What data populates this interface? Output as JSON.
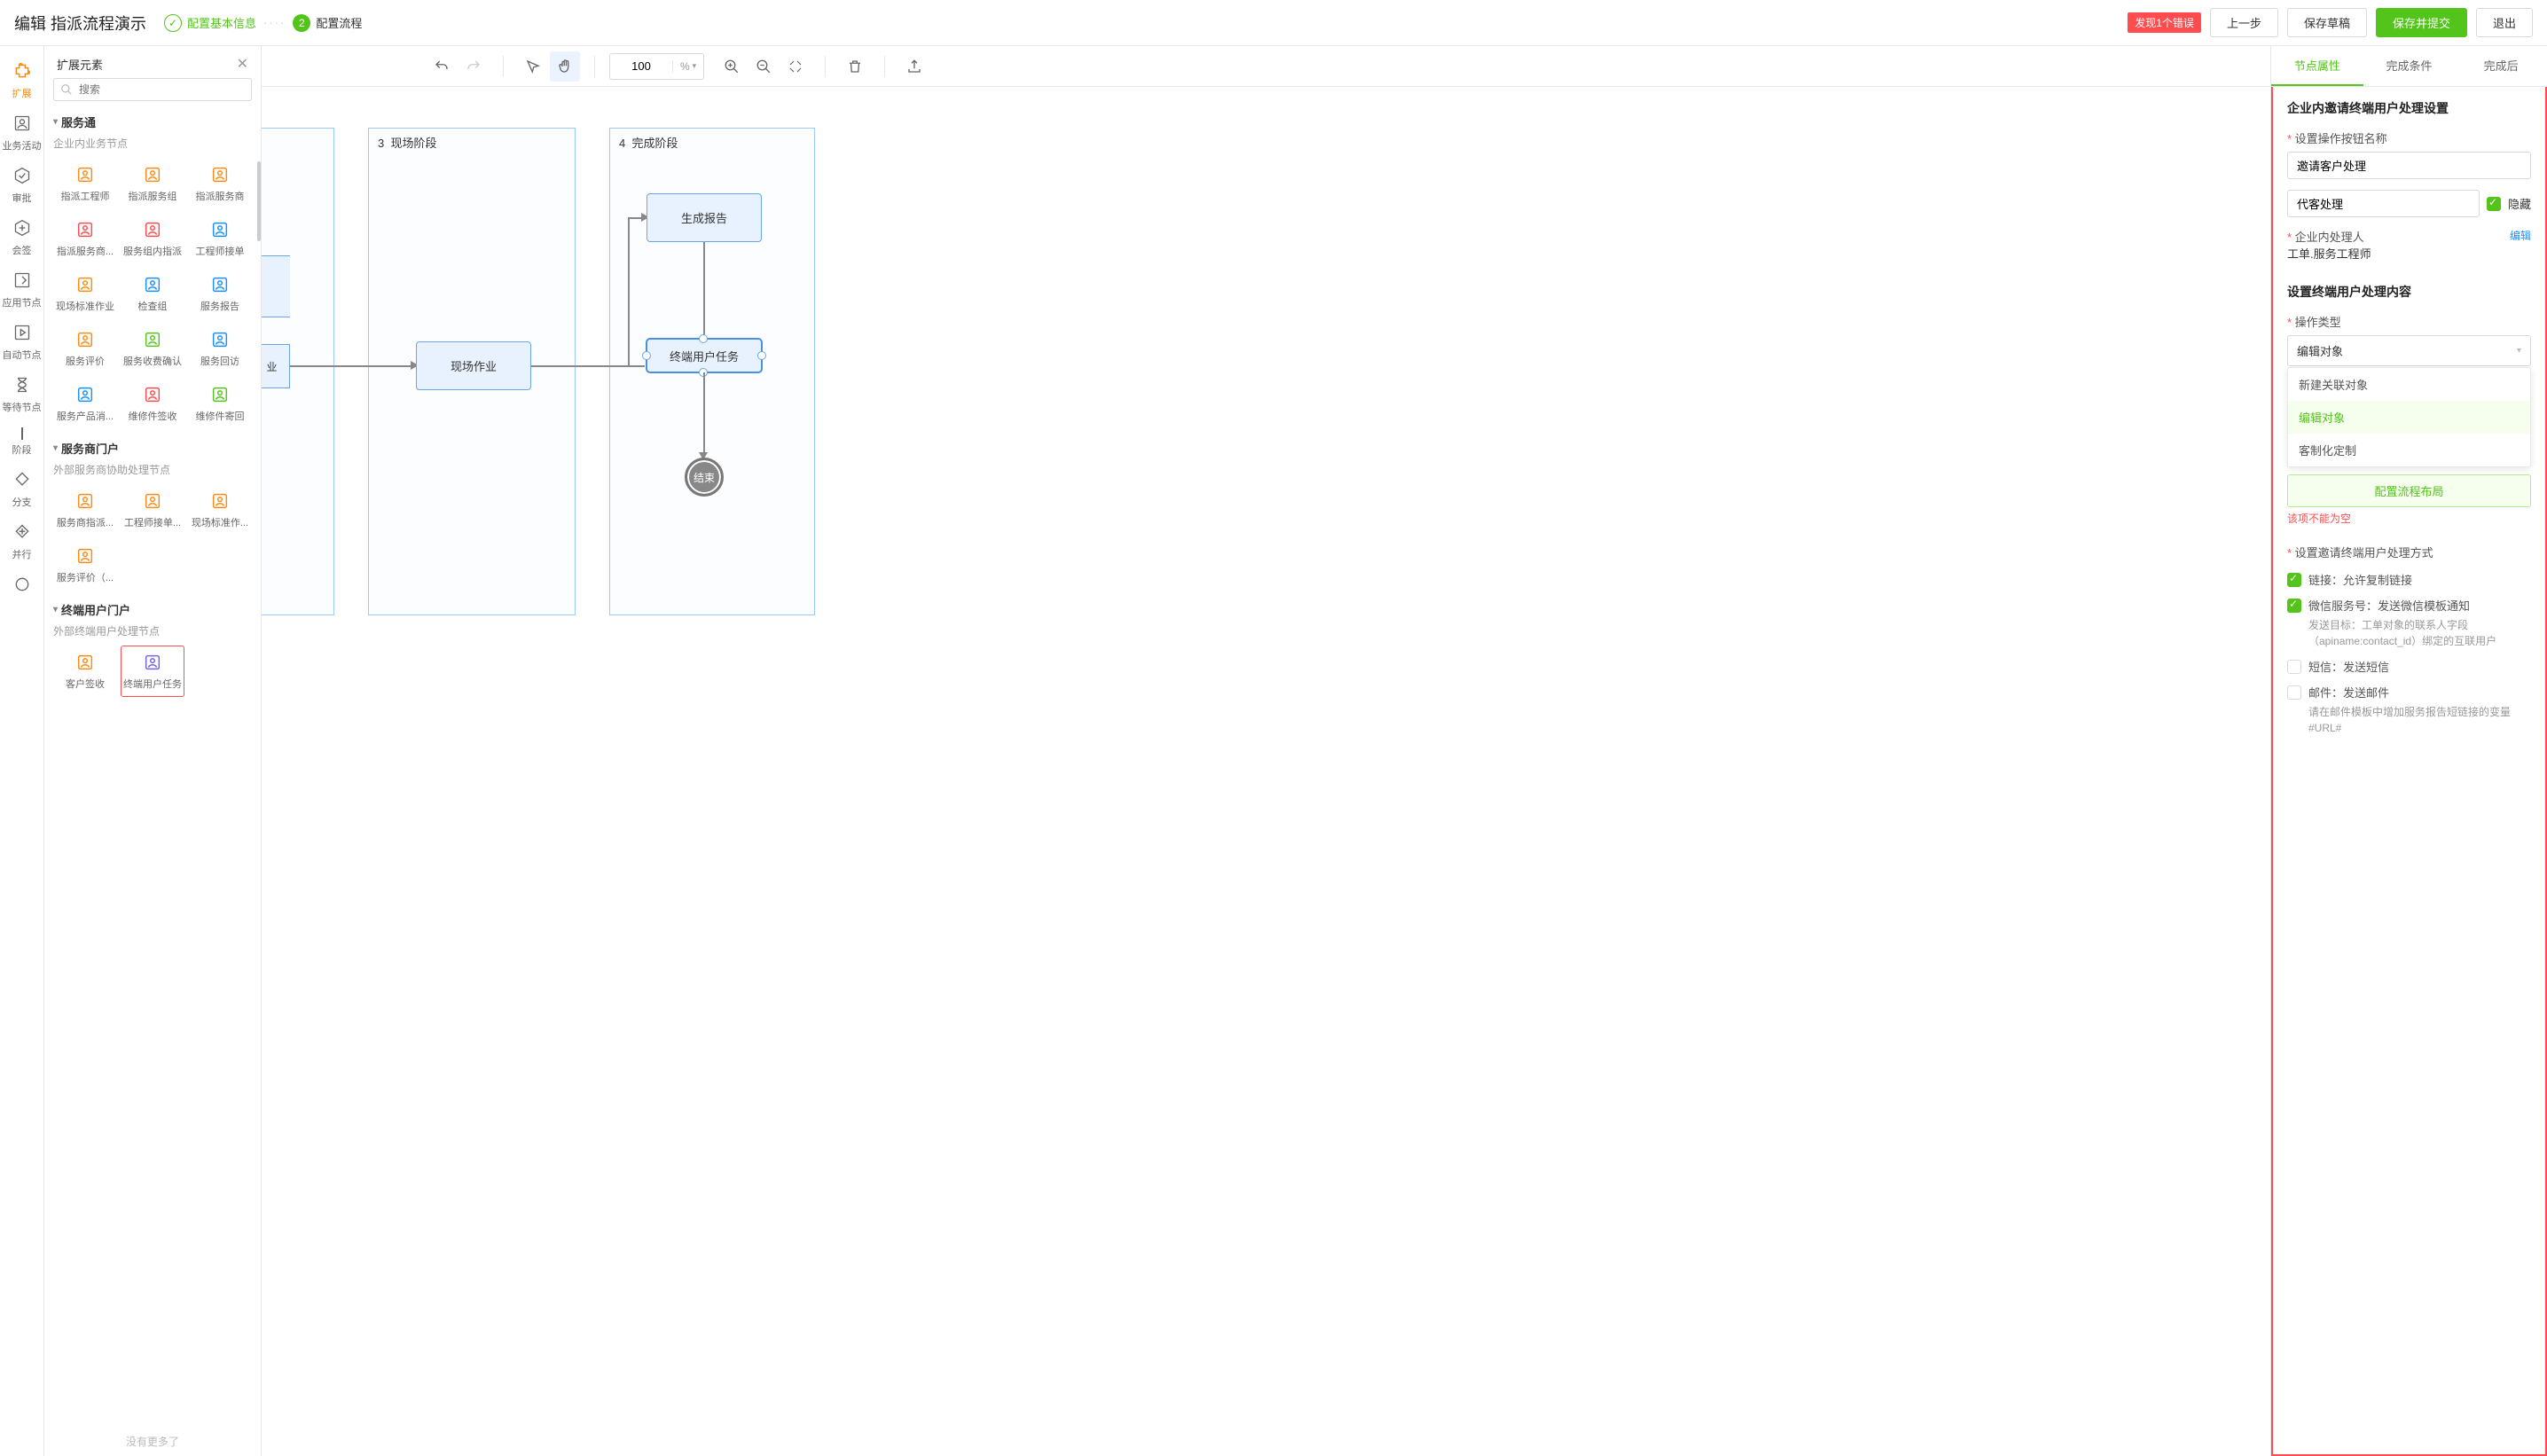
{
  "header": {
    "title": "编辑 指派流程演示",
    "steps": [
      {
        "label": "配置基本信息",
        "state": "done"
      },
      {
        "label": "配置流程",
        "num": "2",
        "state": "active"
      }
    ],
    "error_badge": "发现1个错误",
    "btn_prev": "上一步",
    "btn_draft": "保存草稿",
    "btn_submit": "保存并提交",
    "btn_exit": "退出"
  },
  "iconrail": [
    {
      "id": "extend",
      "label": "扩展"
    },
    {
      "id": "activity",
      "label": "业务活动"
    },
    {
      "id": "approve",
      "label": "审批"
    },
    {
      "id": "counter",
      "label": "会签"
    },
    {
      "id": "appnode",
      "label": "应用节点"
    },
    {
      "id": "autonode",
      "label": "自动节点"
    },
    {
      "id": "waitnode",
      "label": "等待节点"
    },
    {
      "id": "phase",
      "label": "阶段"
    },
    {
      "id": "branch",
      "label": "分支"
    },
    {
      "id": "parallel",
      "label": "并行"
    },
    {
      "id": "more",
      "label": ""
    }
  ],
  "palette": {
    "title": "扩展元素",
    "search_placeholder": "搜索",
    "nomore": "没有更多了",
    "groups": [
      {
        "title": "服务通",
        "subtitle": "企业内业务节点",
        "items": [
          {
            "label": "指派工程师",
            "color": "#fa8c16"
          },
          {
            "label": "指派服务组",
            "color": "#fa8c16"
          },
          {
            "label": "指派服务商",
            "color": "#fa8c16"
          },
          {
            "label": "指派服务商...",
            "color": "#ff4d4f"
          },
          {
            "label": "服务组内指派",
            "color": "#ff4d4f"
          },
          {
            "label": "工程师接单",
            "color": "#1890ff"
          },
          {
            "label": "现场标准作业",
            "color": "#fa8c16"
          },
          {
            "label": "检查组",
            "color": "#1890ff"
          },
          {
            "label": "服务报告",
            "color": "#1890ff"
          },
          {
            "label": "服务评价",
            "color": "#fa8c16"
          },
          {
            "label": "服务收费确认",
            "color": "#52c41a"
          },
          {
            "label": "服务回访",
            "color": "#1890ff"
          },
          {
            "label": "服务产品消...",
            "color": "#1890ff"
          },
          {
            "label": "维修件签收",
            "color": "#ff4d4f"
          },
          {
            "label": "维修件寄回",
            "color": "#52c41a"
          }
        ]
      },
      {
        "title": "服务商门户",
        "subtitle": "外部服务商协助处理节点",
        "items": [
          {
            "label": "服务商指派...",
            "color": "#fa8c16"
          },
          {
            "label": "工程师接单...",
            "color": "#fa8c16"
          },
          {
            "label": "现场标准作...",
            "color": "#fa8c16"
          },
          {
            "label": "服务评价（...",
            "color": "#fa8c16"
          }
        ]
      },
      {
        "title": "终端用户门户",
        "subtitle": "外部终端用户处理节点",
        "items": [
          {
            "label": "客户签收",
            "color": "#fa8c16"
          },
          {
            "label": "终端用户任务",
            "color": "#7265e6",
            "highlight": true
          }
        ]
      }
    ]
  },
  "toolbar": {
    "zoom": "100",
    "zoom_unit": "%"
  },
  "canvas": {
    "phases": [
      {
        "num": "3",
        "label": "现场阶段"
      },
      {
        "num": "4",
        "label": "完成阶段"
      }
    ],
    "nodes": {
      "field_work": "现场作业",
      "gen_report": "生成报告",
      "end_user_task": "终端用户任务",
      "end": "结束"
    }
  },
  "props": {
    "tabs": [
      "节点属性",
      "完成条件",
      "完成后"
    ],
    "section1_title": "企业内邀请终端用户处理设置",
    "btn_name_label": "设置操作按钮名称",
    "btn_name_value": "邀请客户处理",
    "proxy_value": "代客处理",
    "hide_label": "隐藏",
    "handler_label": "企业内处理人",
    "handler_value": "工单.服务工程师",
    "edit_link": "编辑",
    "section2_title": "设置终端用户处理内容",
    "op_type_label": "操作类型",
    "op_type_value": "编辑对象",
    "op_options": [
      "新建关联对象",
      "编辑对象",
      "客制化定制"
    ],
    "config_layout_btn": "配置流程布局",
    "error_empty": "该项不能为空",
    "section3_title": "设置邀请终端用户处理方式",
    "checks": [
      {
        "checked": true,
        "label": "链接：允许复制链接"
      },
      {
        "checked": true,
        "label": "微信服务号：发送微信模板通知",
        "help": "发送目标：工单对象的联系人字段（apiname:contact_id）绑定的互联用户"
      },
      {
        "checked": false,
        "label": "短信：发送短信"
      },
      {
        "checked": false,
        "label": "邮件：发送邮件",
        "help": "请在邮件模板中增加服务报告短链接的变量#URL#"
      }
    ]
  }
}
